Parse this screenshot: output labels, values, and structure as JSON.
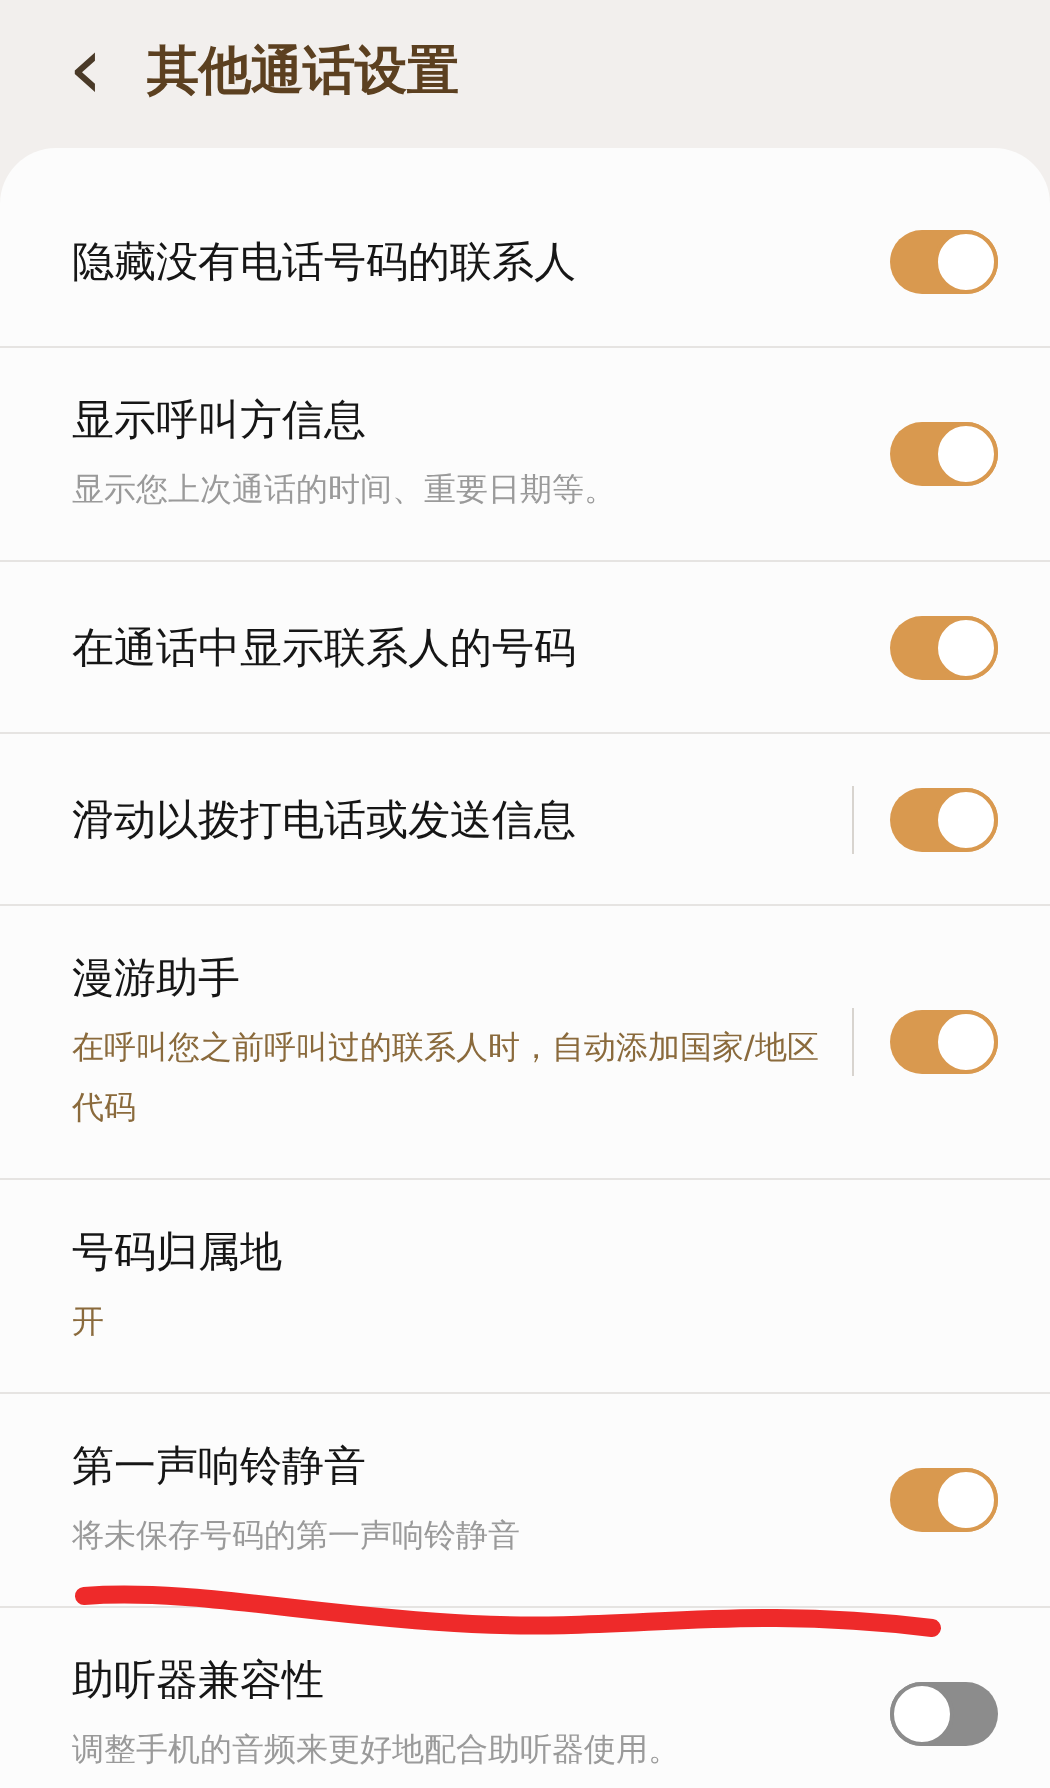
{
  "header": {
    "back_icon": "‹",
    "title": "其他通话设置"
  },
  "settings": [
    {
      "kind": "switch",
      "title": "隐藏没有电话号码的联系人",
      "on": true,
      "has_detail": false
    },
    {
      "kind": "switch",
      "title": "显示呼叫方信息",
      "subtitle": "显示您上次通话的时间、重要日期等。",
      "subtitle_accent": false,
      "on": true,
      "has_detail": false
    },
    {
      "kind": "switch",
      "title": "在通话中显示联系人的号码",
      "on": true,
      "has_detail": false
    },
    {
      "kind": "switch",
      "title": "滑动以拨打电话或发送信息",
      "on": true,
      "has_detail": true
    },
    {
      "kind": "switch",
      "title": "漫游助手",
      "subtitle": "在呼叫您之前呼叫过的联系人时，自动添加国家/地区代码",
      "subtitle_accent": true,
      "on": true,
      "has_detail": true
    },
    {
      "kind": "value",
      "title": "号码归属地",
      "subtitle": "开",
      "subtitle_accent": true
    },
    {
      "kind": "switch",
      "title": "第一声响铃静音",
      "subtitle": "将未保存号码的第一声响铃静音",
      "subtitle_accent": false,
      "on": true,
      "has_detail": false,
      "annotated": true
    },
    {
      "kind": "switch",
      "title": "助听器兼容性",
      "subtitle": "调整手机的音频来更好地配合助听器使用。",
      "subtitle_accent": false,
      "on": false,
      "has_detail": false
    }
  ]
}
